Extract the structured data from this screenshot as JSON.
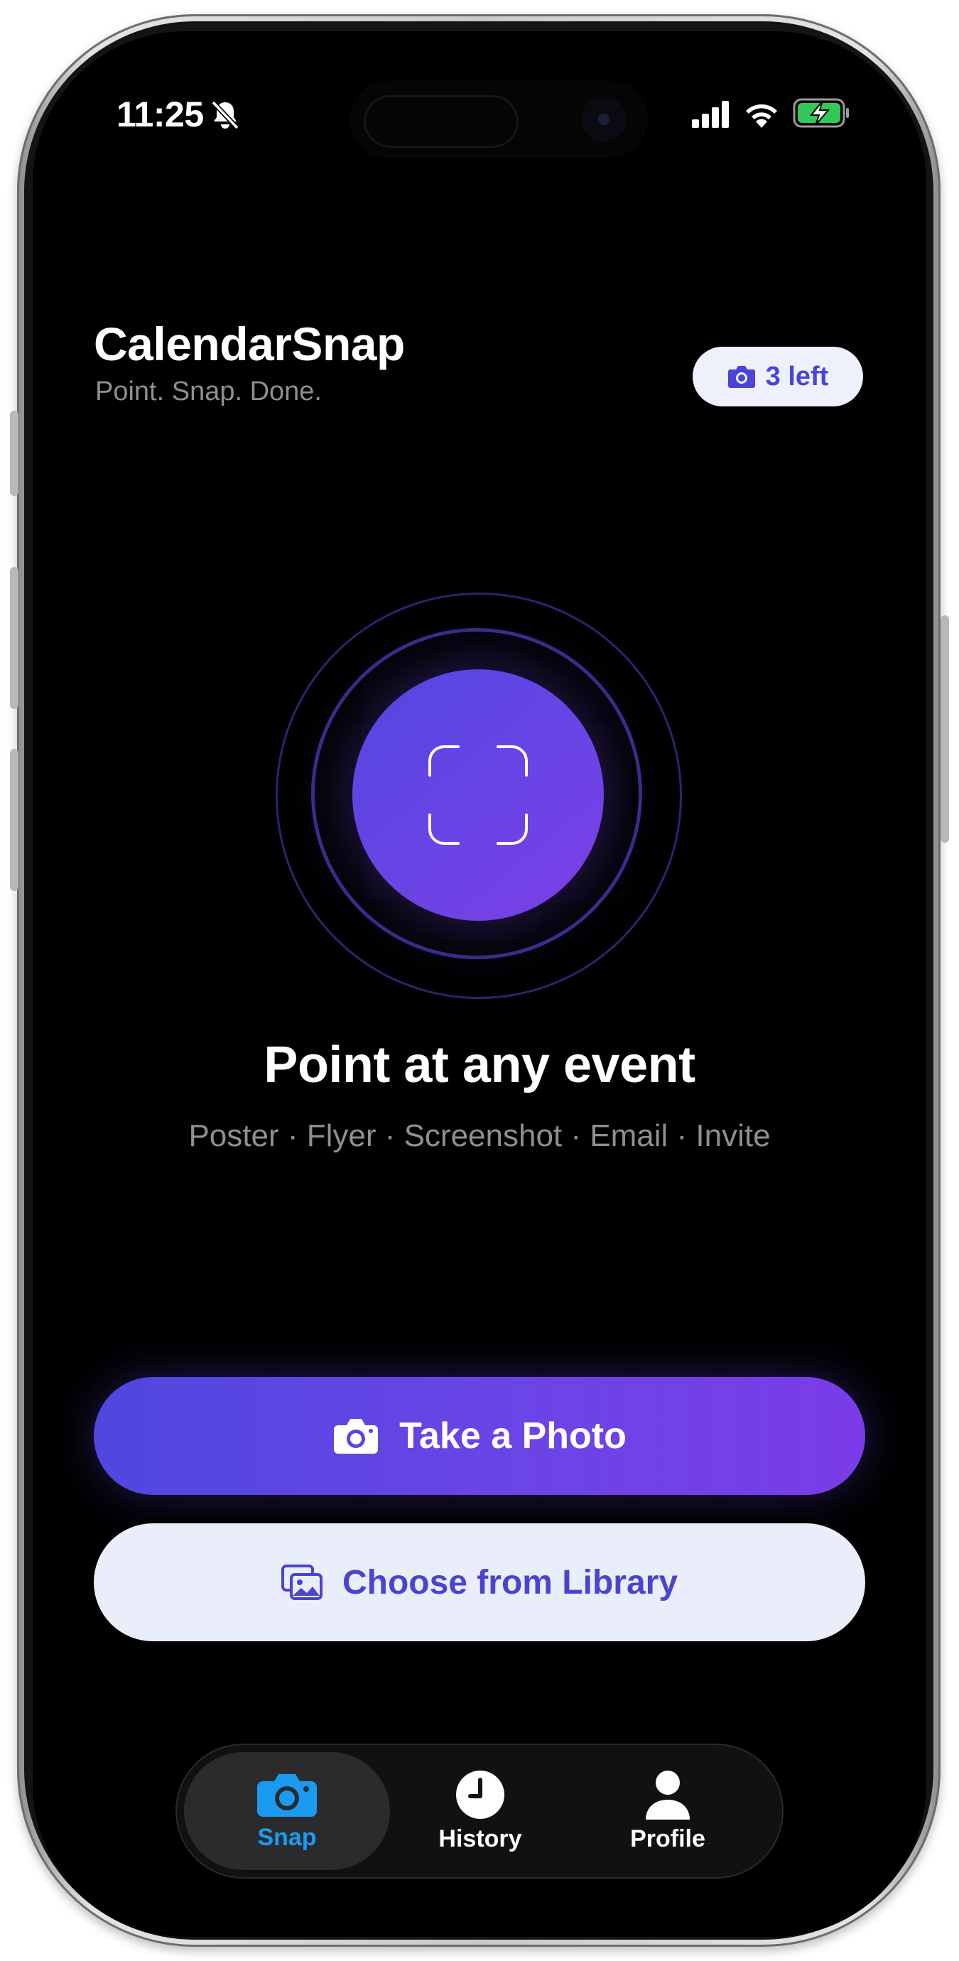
{
  "status_bar": {
    "time": "11:25",
    "icons": [
      "bell-slash-icon",
      "cellular-signal-icon",
      "wifi-icon",
      "battery-charging-icon"
    ]
  },
  "header": {
    "title": "CalendarSnap",
    "subtitle": "Point. Snap. Done.",
    "quota_badge": {
      "icon": "camera-icon",
      "label": "3 left"
    }
  },
  "hero": {
    "icon": "viewfinder-icon",
    "headline": "Point at any event",
    "sources": "Poster · Flyer · Screenshot · Email · Invite"
  },
  "actions": {
    "take_photo": {
      "icon": "camera-icon",
      "label": "Take a Photo"
    },
    "choose_library": {
      "icon": "photo-library-icon",
      "label": "Choose from Library"
    }
  },
  "tabbar": {
    "items": [
      {
        "label": "Snap",
        "icon": "camera-icon",
        "active": true
      },
      {
        "label": "History",
        "icon": "clock-icon",
        "active": false
      },
      {
        "label": "Profile",
        "icon": "person-icon",
        "active": false
      }
    ]
  },
  "colors": {
    "accent": "#5b46e2",
    "accent_end": "#7a3ce8",
    "active_tab": "#1a9bf0",
    "badge_bg": "#eef0fb",
    "battery": "#34c759"
  }
}
